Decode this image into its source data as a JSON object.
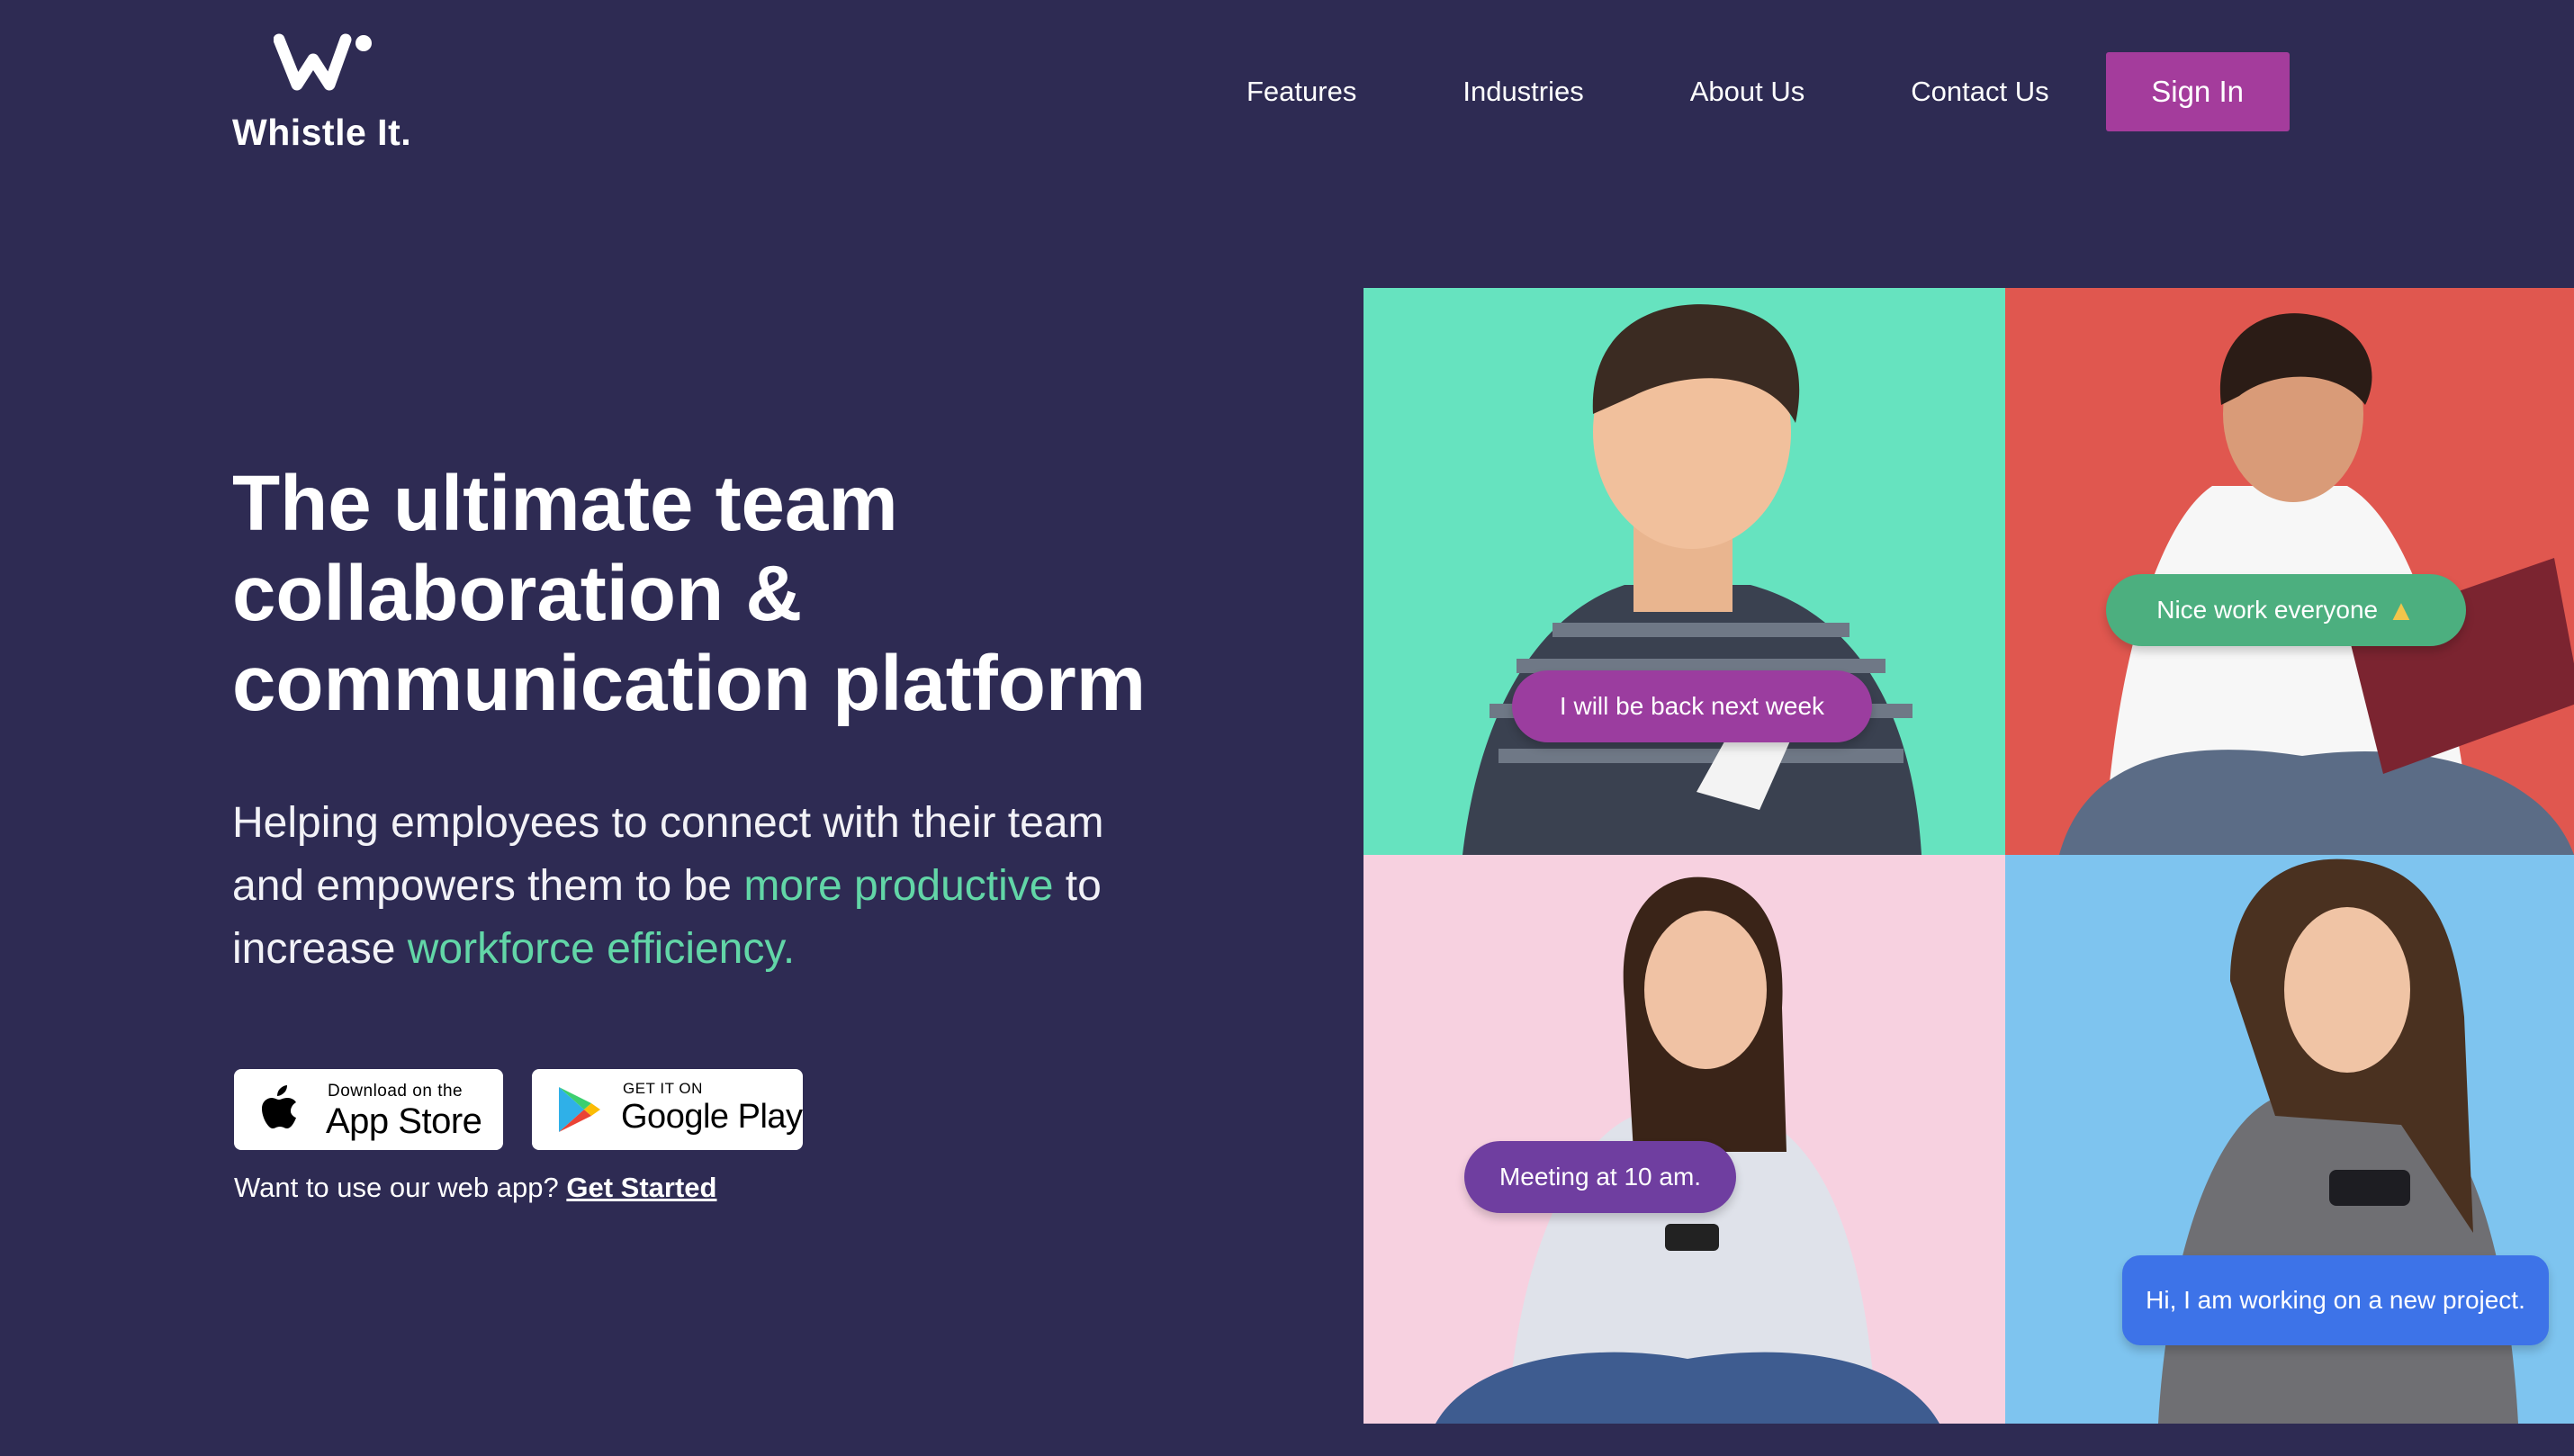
{
  "brand": {
    "name": "Whistle It."
  },
  "nav": {
    "items": [
      "Features",
      "Industries",
      "About Us",
      "Contact Us"
    ],
    "signin_label": "Sign In"
  },
  "hero": {
    "title": "The ultimate team collaboration & communication platform",
    "subtitle_part1": "Helping employees to connect with their team and empowers them to be ",
    "subtitle_accent1": "more productive",
    "subtitle_part2": " to increase ",
    "subtitle_accent2": "workforce efficiency."
  },
  "badges": {
    "apple_small": "Download on the",
    "apple_big": "App Store",
    "google_small": "GET IT ON",
    "google_big": "Google Play"
  },
  "webapp": {
    "prompt": "Want to use our web app?",
    "link": "Get Started"
  },
  "bubbles": {
    "b1": "I will be back next week",
    "b2": "Nice work everyone",
    "b3": "Meeting at 10 am.",
    "b4": "Hi, I am working on a new project."
  },
  "colors": {
    "background": "#2e2b53",
    "accent": "#62d6a7",
    "signin": "#a43c9c"
  },
  "icons": [
    "apple-icon",
    "google-play-icon",
    "thumbs-up-icon",
    "whistle-logo-icon"
  ]
}
